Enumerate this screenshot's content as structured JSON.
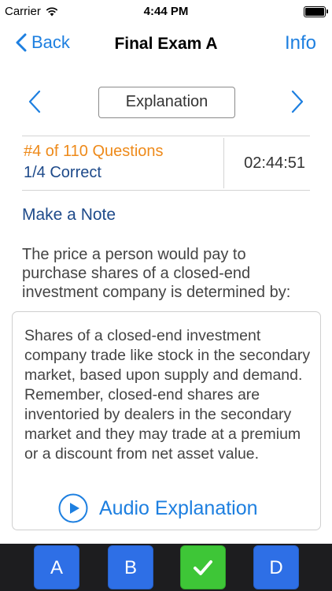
{
  "status": {
    "carrier": "Carrier",
    "time": "4:44 PM"
  },
  "nav": {
    "back_label": "Back",
    "title": "Final Exam A",
    "info_label": "Info"
  },
  "controls": {
    "explanation_label": "Explanation"
  },
  "progress": {
    "question_count": "#4 of 110 Questions",
    "correct": "1/4 Correct",
    "timer": "02:44:51"
  },
  "note": {
    "label": "Make a Note"
  },
  "question": {
    "text": "The price a person would pay to purchase shares of a closed-end investment company is determined by:"
  },
  "explanation": {
    "text": "Shares of a closed-end investment company trade like stock in the secondary market, based upon supply and demand. Remember, closed-end shares are inventoried by dealers in the secondary market and they may trade at a premium or a discount from net asset value.",
    "audio_label": "Audio Explanation"
  },
  "answers": {
    "a": "A",
    "b": "B",
    "d": "D",
    "c_icon": "checkmark-icon"
  },
  "colors": {
    "accent": "#1d7fe0",
    "orange": "#ee8a1a",
    "navy": "#1e4a8a",
    "answer_blue": "#2e6fe6",
    "answer_green": "#3ec637"
  }
}
